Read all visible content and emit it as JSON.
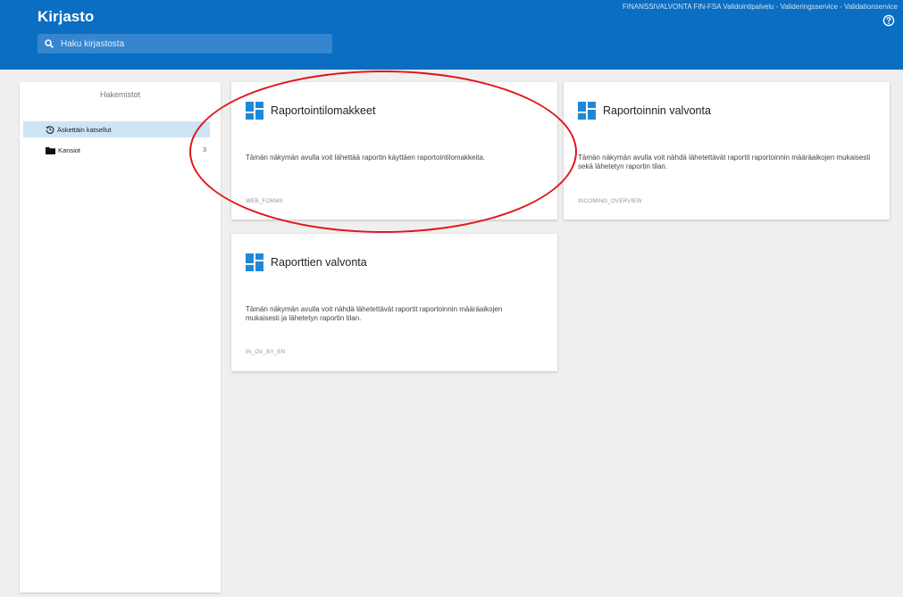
{
  "header": {
    "title": "Kirjasto",
    "search_placeholder": "Haku kirjastosta",
    "service_text": "FINANSSIVALVONTA FIN-FSA Validointipalvelu - Valideringsservice - Validationservice"
  },
  "sidebar": {
    "title": "Hakemistot",
    "items": [
      {
        "label": "Äskettäin katsellut",
        "icon": "history-icon",
        "count": ""
      },
      {
        "label": "Kansiot",
        "icon": "folder-icon",
        "count": "3"
      }
    ]
  },
  "cards": [
    {
      "title": "Raportointilomakkeet",
      "description": "Tämän näkymän avulla voit lähettää raportin käyttäen raportointilomakkeita.",
      "code": "WEB_FORMS"
    },
    {
      "title": "Raportoinnin valvonta",
      "description": "Tämän näkymän avulla voit nähdä lähetettävät raportit raportoinnin määräaikojen mukaisesti sekä lähetetyn raportin tilan.",
      "code": "INCOMING_OVERVIEW"
    },
    {
      "title": "Raporttien valvonta",
      "description": "Tämän näkymän avulla voit nähdä lähetettävät raportit raportoinnin määräaikojen mukaisesti ja lähetetyn raportin tilan.",
      "code": "IN_OV_BY_EN"
    }
  ],
  "colors": {
    "header": "#0a6ec2",
    "accent_icon": "#1f88d6",
    "selected": "#cde4f5",
    "annotation": "#e2141c"
  }
}
